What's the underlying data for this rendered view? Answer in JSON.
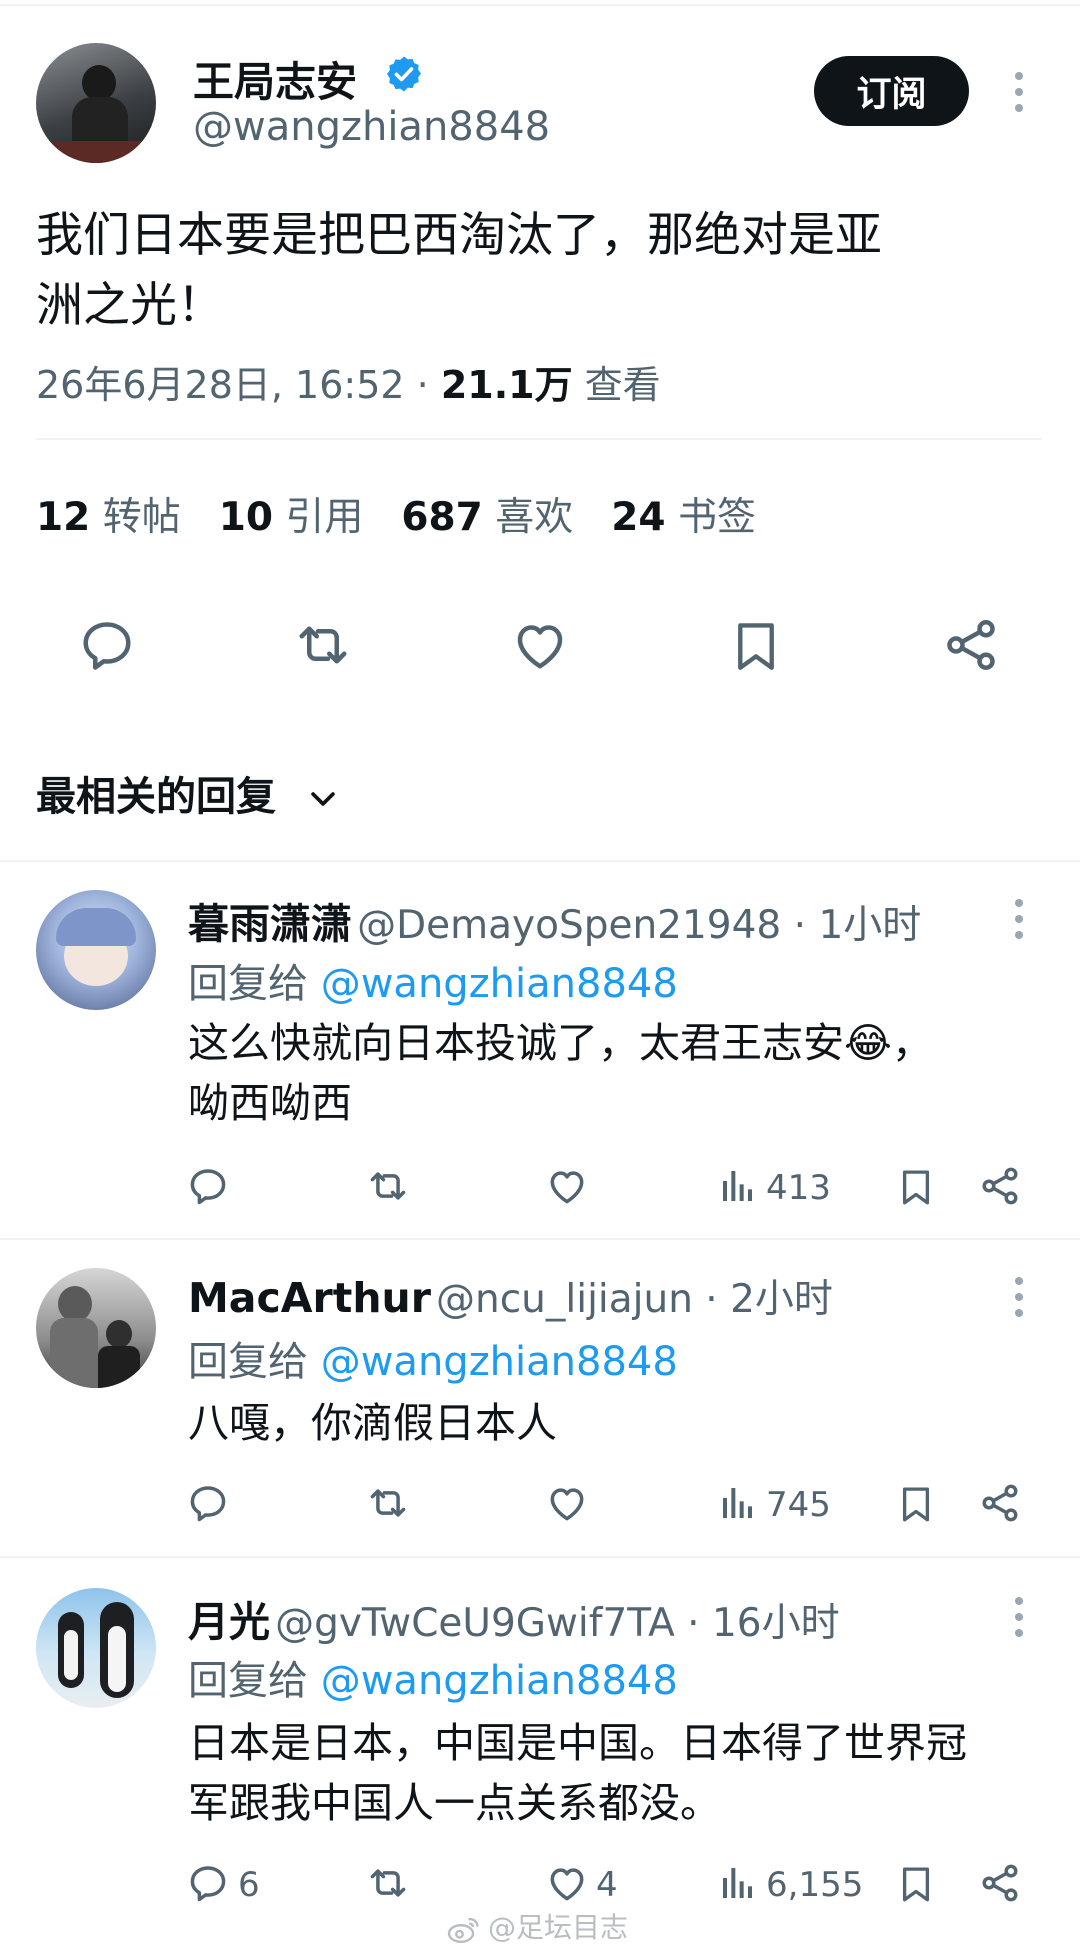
{
  "tweet": {
    "author_name": "王局志安",
    "handle": "@wangzhian8848",
    "subscribe_label": "订阅",
    "text_line1": "我们日本要是把巴西淘汰了，那绝对是亚",
    "text_line2": "洲之光！",
    "timestamp": "26年6月28日, 16:52",
    "separator": " · ",
    "views_count": "21.1万",
    "views_label": "查看"
  },
  "stats": [
    {
      "num": "12",
      "label": "转帖"
    },
    {
      "num": "10",
      "label": "引用"
    },
    {
      "num": "687",
      "label": "喜欢"
    },
    {
      "num": "24",
      "label": "书签"
    }
  ],
  "replies_header": "最相关的回复",
  "replies": [
    {
      "name": "暮雨潇潇",
      "handle": "@DemayoSpen21948",
      "time": " · 1小时",
      "reply_to_label": "回复给",
      "reply_to_handle": "@wangzhian8848",
      "text_line1": "这么快就向日本投诚了，太君王志安😂，",
      "text_line2": "呦西呦西",
      "reply_count": "",
      "like_count": "",
      "views": "413"
    },
    {
      "name": "MacArthur",
      "handle": "@ncu_lijiajun",
      "time": " · 2小时",
      "reply_to_label": "回复给",
      "reply_to_handle": "@wangzhian8848",
      "text_line1": "八嘎，你滴假日本人",
      "text_line2": "",
      "reply_count": "",
      "like_count": "",
      "views": "745"
    },
    {
      "name": "月光",
      "handle": "@gvTwCeU9Gwif7TA",
      "time": " · 16小时",
      "reply_to_label": "回复给",
      "reply_to_handle": "@wangzhian8848",
      "text_line1": "日本是日本，中国是中国。日本得了世界冠",
      "text_line2": "军跟我中国人一点关系都没。",
      "reply_count": "6",
      "like_count": "4",
      "views": "6,155"
    }
  ],
  "watermark": "@足坛目志",
  "colors": {
    "accent": "#1d9bf0",
    "text": "#0f1419",
    "muted": "#536471",
    "divider": "#eff3f4"
  }
}
